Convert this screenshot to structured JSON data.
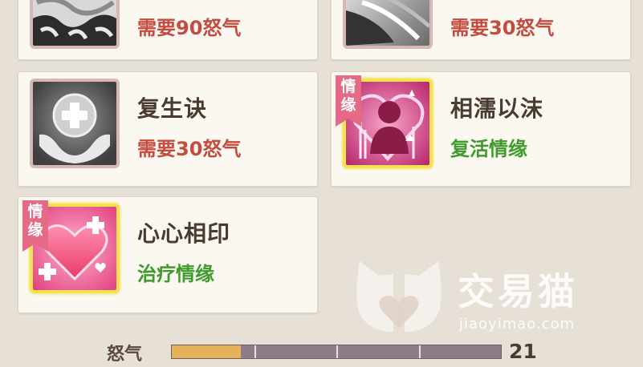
{
  "skills": [
    {
      "title": "",
      "requirement": "需要90怒气",
      "req_color": "red",
      "icon": "tiger-stripe-skill-icon",
      "partial": true
    },
    {
      "title": "",
      "requirement": "需要30怒气",
      "req_color": "red",
      "icon": "feather-wing-skill-icon",
      "partial": true
    },
    {
      "title": "复生诀",
      "requirement": "需要30怒气",
      "req_color": "red",
      "icon": "revive-hands-cross-icon"
    },
    {
      "title": "相濡以沫",
      "requirement": "复活情缘",
      "req_color": "green",
      "icon": "couple-revive-icon",
      "badge": "情\n缘"
    },
    {
      "title": "心心相印",
      "requirement": "治疗情缘",
      "req_color": "green",
      "icon": "heart-heal-icon",
      "badge": "情\n缘"
    }
  ],
  "rage": {
    "label": "怒气",
    "value": "21",
    "fill_fraction": 0.21,
    "segments": 4,
    "fill_color": "#e5b25a",
    "empty_color": "#8d7b86"
  },
  "watermark": {
    "title": "交易猫",
    "url": "jiaoyimao.com"
  },
  "colors": {
    "requirement_red": "#c44b3e",
    "bond_green": "#3e9a2b",
    "title_brown": "#4a3b31",
    "badge_pink": "#e46a86",
    "gold_frame": "#f4e34c"
  }
}
